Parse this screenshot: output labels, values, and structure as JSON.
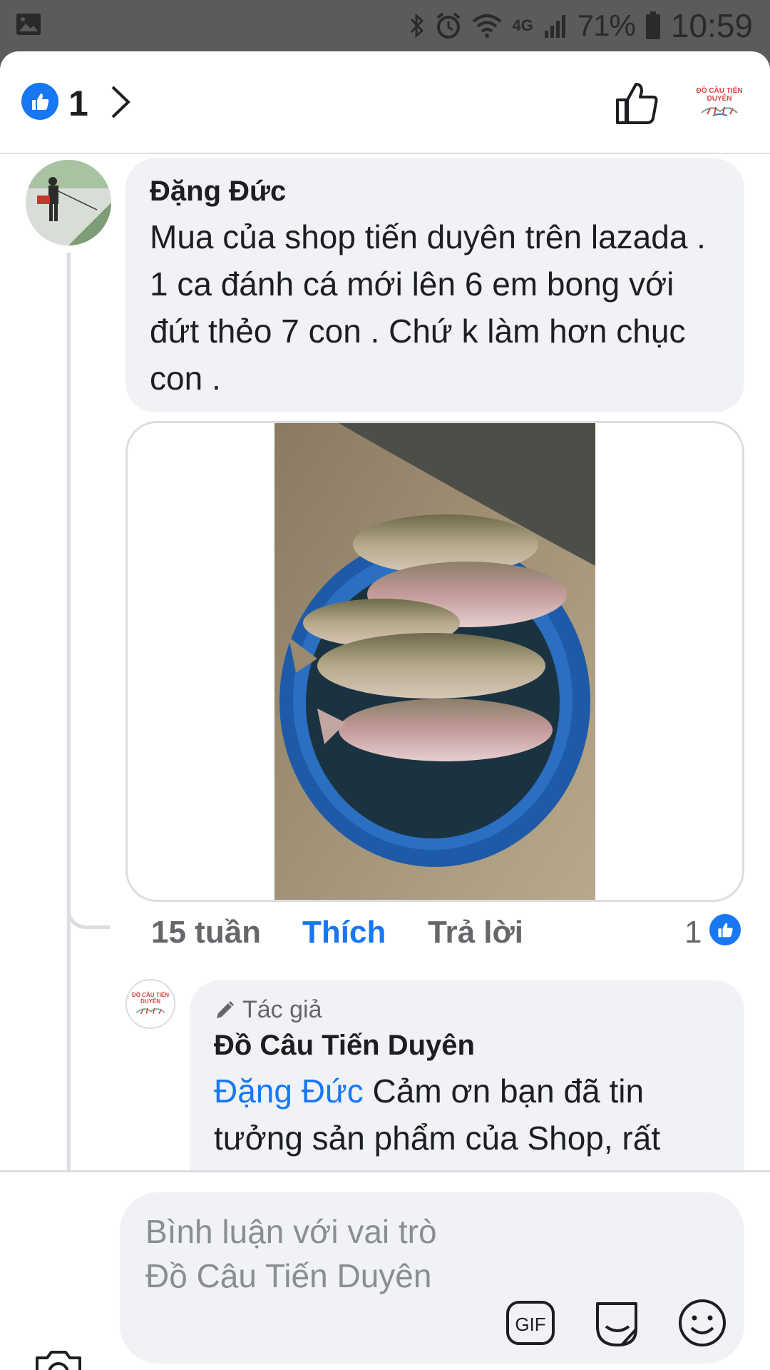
{
  "status_bar": {
    "network": "4G",
    "battery": "71%",
    "time": "10:59"
  },
  "header": {
    "reaction_count": "1",
    "page_logo_text": "ĐỒ CÂU TIẾN DUYÊN"
  },
  "comment": {
    "author": "Đặng Đức",
    "text": "Mua của shop tiến duyên trên lazada . 1 ca đánh cá mới lên 6 em bong với đứt thẻo 7 con . Chứ k làm hơn chục con .",
    "time": "15 tuần",
    "like_label": "Thích",
    "reply_label": "Trả lời",
    "reaction_count": "1"
  },
  "reply": {
    "badge": "Tác giả",
    "author": "Đồ Câu Tiến Duyên",
    "mention": "Đặng Đức",
    "text": " Cảm ơn bạn đã tin tưởng sản phẩm của Shop, rất hân hạnh được phục vụ bạn"
  },
  "composer": {
    "placeholder": "Bình luận với vai trò Đồ Câu Tiến Duyên",
    "gif_label": "GIF"
  },
  "colors": {
    "accent": "#1877f2",
    "bubble": "#f0f2f5",
    "muted": "#65676b"
  }
}
